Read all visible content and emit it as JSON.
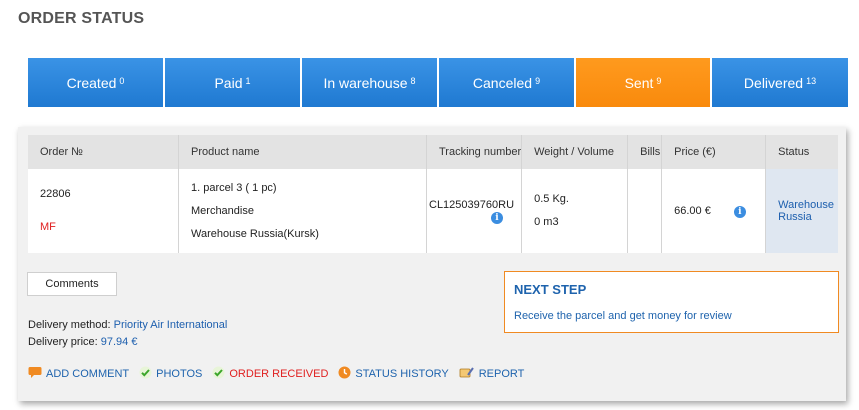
{
  "title": "ORDER STATUS",
  "tabs": [
    {
      "label": "Created",
      "count": "0"
    },
    {
      "label": "Paid",
      "count": "1"
    },
    {
      "label": "In warehouse",
      "count": "8"
    },
    {
      "label": "Canceled",
      "count": "9"
    },
    {
      "label": "Sent",
      "count": "9"
    },
    {
      "label": "Delivered",
      "count": "13"
    }
  ],
  "active_tab": "Sent",
  "table": {
    "headers": [
      "Order №",
      "Product name",
      "Tracking number",
      "Weight / Volume",
      "Bills",
      "Price (€)",
      "Status"
    ],
    "row": {
      "order_no": "22806",
      "order_tag": "MF",
      "product_line1": "1. parcel 3 ( 1 pc)",
      "product_line2": "Merchandise",
      "product_line3": "Warehouse Russia(Kursk)",
      "tracking": "CL125039760RU",
      "weight": "0.5 Kg.",
      "volume": "0 m3",
      "bills": "",
      "price": "66.00 €",
      "status_line1": "Warehouse",
      "status_line2": "Russia"
    }
  },
  "comments_label": "Comments",
  "delivery": {
    "method_label": "Delivery method:",
    "method_value": "Priority Air International",
    "price_label": "Delivery price:",
    "price_value": "97.94 €"
  },
  "next_step": {
    "title": "NEXT STEP",
    "text": "Receive the parcel and get money for review"
  },
  "actions": [
    {
      "label": "ADD COMMENT",
      "icon": "speech-bubble-icon",
      "color": "#1e63ad"
    },
    {
      "label": "PHOTOS",
      "icon": "check-icon",
      "color": "#1e63ad"
    },
    {
      "label": "ORDER RECEIVED",
      "icon": "check-icon",
      "color": "#e02020"
    },
    {
      "label": "STATUS HISTORY",
      "icon": "clock-icon",
      "color": "#1e63ad"
    },
    {
      "label": "REPORT",
      "icon": "report-icon",
      "color": "#1e63ad"
    }
  ],
  "colors": {
    "tab_blue": "#2b87dd",
    "tab_active": "#fb8c10",
    "link": "#1e63ad",
    "accent_border": "#f08a22"
  }
}
